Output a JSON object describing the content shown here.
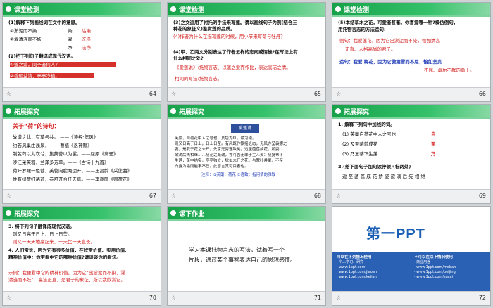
{
  "slides": [
    {
      "number": "64",
      "header": "课堂检测",
      "lines": [
        "(1)解释下列画线词在文中的意思。",
        "①淤泥而不染",
        "②濯清涟而不妖",
        "(2)把下列句子翻译成现代汉语。",
        "①莲之爱，同予者何人？",
        "②香远益清，亭亭净植。"
      ],
      "annotations": [
        "染",
        "濯",
        "净"
      ],
      "answers": [
        "沾染",
        "洗涤",
        "洁净"
      ]
    },
    {
      "number": "65",
      "header": "课堂检测",
      "lines": [
        "(3)之文运用了衬托的手法来写莲。请以画线句子为例(结合三",
        "种花的象征义)鉴赏莲的品质。",
        "(4)作者为什么在描写莲的时候，用小节来写菊与牡丹？",
        "(4)甲、乙两文分别表达了作者怎样的志向或情操?在写法上有",
        "什么相同之处?",
        "《爱莲说》:托物言志、以莲之爱而作比，表达高洁之情。",
        "相同的写法:托物言志。"
      ]
    },
    {
      "number": "66",
      "header": "课堂检测",
      "lines": [
        "(5)本结草木之花，可爱者甚蕃。你喜爱哪一种?模仿例句，",
        "用托物言志的方法造句:",
        "例句：我爱莲花，因为它出淤泥而不染，恰如清高",
        "正直、人格高尚的君子。",
        "造句：我爱 梅花，因为它傲霜雪而不屈，恰如坚贞",
        "不屈、卓尔不群的勇士。"
      ]
    },
    {
      "number": "67",
      "header": "拓展探究",
      "lines": [
        "关于“荷”的诗句：",
        "故谱之此，有莫与共。  ——《诗经·陈风》",
        "约若风巢由浅泉，     ——曹植《洛神赋》",
        "制芰荷以为衣兮，集芙蓉以为裳。——屈原《离骚》",
        "涉江采芙蓉，兰泽多芳草。——《古诗十九首》",
        "荷叶罗裙一色裁，芙蓉向脸两边开。——王昌龄《采莲曲》",
        "惟有绿荷红菡萏，卷舒开合任天真。——李商隐《赠荷花》"
      ]
    },
    {
      "number": "68",
      "header": "拓展探究",
      "emblem": "爱莲说",
      "lines": [
        "芙蕖，自荷花中人之号也，其色为红，最为艳。",
        "则又日高于日上，日上日莹。有风既作飘摇之态，无风亦呈袅娜之",
        "姿，是我于花之未开，先享无穷逸致矣。迨至菡萏成花，娇姿",
        "欲滴后先相继……及花之既谢，亦可告无罪于主人矣：及复蒂下",
        "生莲，蓬中结实，亭亭独立，犹似未开之花，与翠叶并擎，不至",
        "白露为霜而能事不已。此皆言其可目者也。",
        "注释：①芙蕖：荷花 ②逸致：指闲情的雅致"
      ]
    },
    {
      "number": "69",
      "header": "拓展探究",
      "lines": [
        "1. 解释下列句中加线的词。",
        "(1) 芙蕖自荷花中人之号也",
        "(2) 及至菡萏成花",
        "(3) 乃复蒂下生蓬",
        "2.(给下面句子加句读停顿)(标两处)",
        "迨 至 菡 萏 成 花 娇 姿 欲 滴 后 先 相 继"
      ],
      "answers": [
        "自",
        "至",
        "乃"
      ]
    },
    {
      "number": "70",
      "header": "拓展探究",
      "lines": [
        "3. 将下列句子翻译成现代汉语。",
        "则又日高于日上，日上日莹。",
        "则又一天天地高起来，一天比一天直长。",
        "4. 人们常说，因为它有很多价值，在欣赏价值、实用价值、",
        "精神价值中：你更看中它的哪种价值?请谈谈你的看法。",
        "示例：我更看中它的精神价值。因为它“出淤泥而不染，濯",
        "清涟而不妖”，高洁正直，是君子的象征，所以我欣赏它。"
      ]
    },
    {
      "number": "71",
      "header": "课下作业",
      "lines": [
        "学习本课托物言志的写法，试着写一个",
        "片段，通过某个事物表达自己的思想感情。"
      ]
    },
    {
      "number": "72",
      "logo": "第一PPT",
      "panel_left_title": "可以在下列情况使用",
      "panel_right_title": "不可以在以下情况使用",
      "panel_left_lines": [
        "· 个人学习、研究",
        "· www.1ppt.com",
        "· www.1ppt.com/jiaoan",
        "· www.1ppt.com/kejian"
      ],
      "panel_right_lines": [
        "· 商业用途",
        "· www.1ppt.com/moban",
        "· www.1ppt.com/beijing",
        "· www.1ppt.com/sucai"
      ]
    }
  ]
}
